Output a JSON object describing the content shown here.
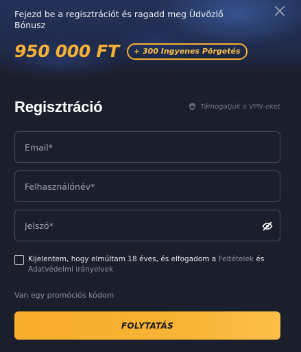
{
  "banner": {
    "headline": "Fejezd be a regisztrációt és ragadd meg Üdvözlő Bónusz",
    "amount": "950 000 FT",
    "spins": "+ 300 Ingyenes Pörgetés"
  },
  "form": {
    "title": "Regisztráció",
    "vpn_note": "Támogatjuk a VPN-eket",
    "email_placeholder": "Email*",
    "username_placeholder": "Felhasználónév*",
    "password_placeholder": "Jelszó*",
    "terms_prefix": "Kijelentem, hogy elmúltam 18 éves, és elfogadom a ",
    "terms_link": "Feltételek",
    "terms_and": " és ",
    "privacy_link": "Adatvédelmi irányelvek",
    "promo_link": "Van egy promóciós kódom",
    "submit_label": "FOLYTATÁS"
  },
  "colors": {
    "accent": "#f7b134",
    "background": "#1b1e2b",
    "field_border": "#4a4d5c"
  },
  "icons": {
    "close": "close-icon",
    "vpn": "shield-icon",
    "password_toggle": "eye-slash-icon"
  }
}
